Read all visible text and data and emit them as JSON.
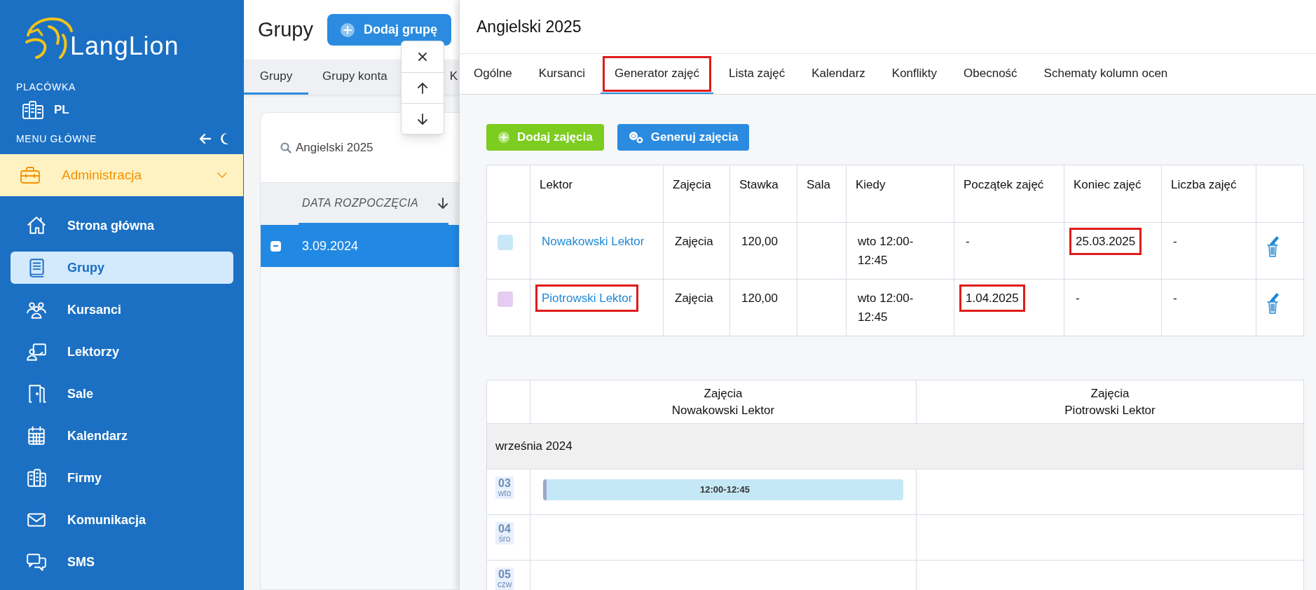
{
  "sidebar": {
    "brand": "LangLion",
    "branch_label": "PLACÓWKA",
    "branch": "PL",
    "menu_label": "MENU GŁÓWNE",
    "group": {
      "label": "Administracja",
      "expanded": true
    },
    "items": [
      {
        "label": "Strona główna",
        "selected": false
      },
      {
        "label": "Grupy",
        "selected": true
      },
      {
        "label": "Kursanci",
        "selected": false
      },
      {
        "label": "Lektorzy",
        "selected": false
      },
      {
        "label": "Sale",
        "selected": false
      },
      {
        "label": "Kalendarz",
        "selected": false
      },
      {
        "label": "Firmy",
        "selected": false
      },
      {
        "label": "Komunikacja",
        "selected": false
      },
      {
        "label": "SMS",
        "selected": false
      }
    ]
  },
  "groups_panel": {
    "title": "Grupy",
    "add_button": "Dodaj grupę",
    "tabs": [
      {
        "label": "Grupy",
        "selected": true
      },
      {
        "label": "Grupy konta",
        "selected": false
      },
      {
        "label": "K",
        "selected": false
      }
    ],
    "search": {
      "value": "Angielski 2025"
    },
    "column": "DATA ROZPOCZĘCIA",
    "rows": [
      {
        "date": "3.09.2024",
        "selected": true
      }
    ]
  },
  "detail": {
    "title": "Angielski 2025",
    "tabs": [
      {
        "label": "Ogólne",
        "selected": false,
        "highlighted": false
      },
      {
        "label": "Kursanci",
        "selected": false,
        "highlighted": false
      },
      {
        "label": "Generator zajęć",
        "selected": true,
        "highlighted": true
      },
      {
        "label": "Lista zajęć",
        "selected": false,
        "highlighted": false
      },
      {
        "label": "Kalendarz",
        "selected": false,
        "highlighted": false
      },
      {
        "label": "Konflikty",
        "selected": false,
        "highlighted": false
      },
      {
        "label": "Obecność",
        "selected": false,
        "highlighted": false
      },
      {
        "label": "Schematy kolumn ocen",
        "selected": false,
        "highlighted": false
      }
    ],
    "buttons": [
      {
        "label": "Dodaj zajęcia",
        "kind": "add"
      },
      {
        "label": "Generuj zajęcia",
        "kind": "generate"
      }
    ],
    "table": {
      "columns": [
        "Lektor",
        "Zajęcia",
        "Stawka",
        "Sala",
        "Kiedy",
        "Początek zajęć",
        "Koniec zajęć",
        "Liczba zajęć"
      ],
      "rows": [
        {
          "color": "#c8e8f7",
          "cells": [
            {
              "kind": "link",
              "text": "Nowakowski Lektor",
              "highlighted": false
            },
            {
              "kind": "text",
              "text": "Zajęcia",
              "highlighted": false
            },
            {
              "kind": "text",
              "text": "120,00",
              "highlighted": false
            },
            {
              "kind": "empty"
            },
            {
              "kind": "text",
              "text": "wto 12:00-12:45",
              "highlighted": false
            },
            {
              "kind": "text",
              "text": "-",
              "highlighted": false
            },
            {
              "kind": "text",
              "text": "25.03.2025",
              "highlighted": true
            },
            {
              "kind": "text",
              "text": "-",
              "highlighted": false
            }
          ]
        },
        {
          "color": "#e6ccf0",
          "cells": [
            {
              "kind": "link",
              "text": "Piotrowski Lektor",
              "highlighted": true
            },
            {
              "kind": "text",
              "text": "Zajęcia",
              "highlighted": false
            },
            {
              "kind": "text",
              "text": "120,00",
              "highlighted": false
            },
            {
              "kind": "empty"
            },
            {
              "kind": "text",
              "text": "wto 12:00-12:45",
              "highlighted": false
            },
            {
              "kind": "text",
              "text": "1.04.2025",
              "highlighted": true
            },
            {
              "kind": "text",
              "text": "-",
              "highlighted": false
            },
            {
              "kind": "text",
              "text": "-",
              "highlighted": false
            }
          ]
        }
      ]
    },
    "schedule": {
      "columns": [
        {
          "title": "Zajęcia",
          "subtitle": "Nowakowski Lektor"
        },
        {
          "title": "Zajęcia",
          "subtitle": "Piotrowski Lektor"
        }
      ],
      "month": "września 2024",
      "days": [
        {
          "day": "03",
          "weekday": "wto",
          "slots": [
            {
              "kind": "event",
              "text": "12:00-12:45"
            },
            {
              "kind": "empty"
            }
          ]
        },
        {
          "day": "04",
          "weekday": "śro",
          "slots": [
            {
              "kind": "empty"
            },
            {
              "kind": "empty"
            }
          ]
        },
        {
          "day": "05",
          "weekday": "czw",
          "slots": [
            {
              "kind": "empty"
            },
            {
              "kind": "empty"
            }
          ]
        }
      ]
    }
  }
}
